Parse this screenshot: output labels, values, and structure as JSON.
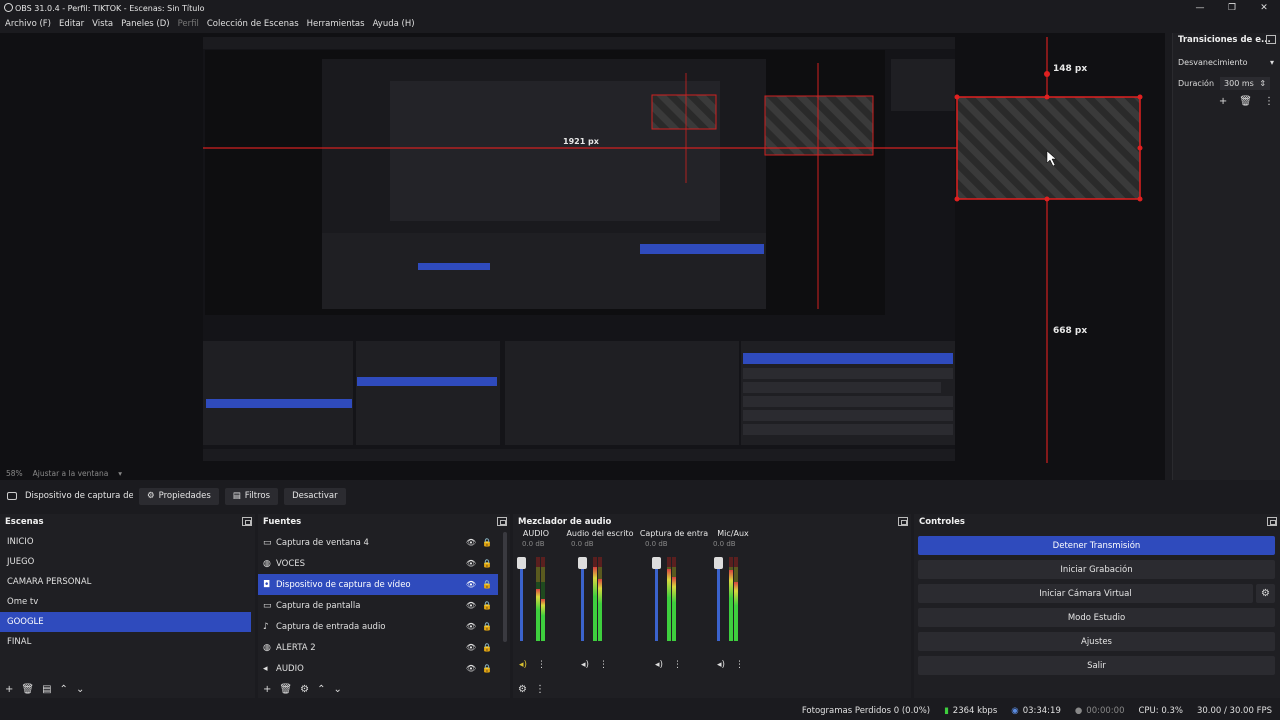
{
  "window": {
    "title": "OBS 31.0.4 - Perfil: TIKTOK - Escenas: Sin Título",
    "minimize": "—",
    "maximize": "❐",
    "close": "✕"
  },
  "menu": [
    "Archivo (F)",
    "Editar",
    "Vista",
    "Paneles (D)",
    "Perfil",
    "Colección de Escenas",
    "Herramientas",
    "Ayuda (H)"
  ],
  "preview": {
    "labels": [
      "148 px",
      "668 px",
      "1921 px"
    ],
    "zoom": "58%",
    "zoom_mode": "Ajustar a la ventana"
  },
  "transitions": {
    "title": "Transiciones de e...",
    "selected": "Desvanecimiento",
    "duration_label": "Duración",
    "duration_value": "300 ms"
  },
  "context": {
    "source_name": "Dispositivo de captura de v",
    "properties": "Propiedades",
    "filters": "Filtros",
    "deactivate": "Desactivar"
  },
  "scenes": {
    "title": "Escenas",
    "items": [
      "INICIO",
      "JUEGO",
      "CAMARA PERSONAL",
      "Ome tv",
      "GOOGLE",
      "FINAL"
    ],
    "selected_index": 4
  },
  "sources": {
    "title": "Fuentes",
    "items": [
      {
        "label": "Captura de ventana 4",
        "icon": "window-icon"
      },
      {
        "label": "VOCES",
        "icon": "globe-icon"
      },
      {
        "label": "Dispositivo de captura de vídeo",
        "icon": "camera-icon"
      },
      {
        "label": "Captura de pantalla",
        "icon": "monitor-icon"
      },
      {
        "label": "Captura de entrada audio",
        "icon": "mic-icon"
      },
      {
        "label": "ALERTA 2",
        "icon": "globe-icon"
      },
      {
        "label": "AUDIO",
        "icon": "speaker-icon"
      }
    ],
    "selected_index": 2
  },
  "mixer": {
    "title": "Mezclador de audio",
    "channels": [
      {
        "name": "AUDIO",
        "db": "0.0 dB",
        "level_l": 0.62,
        "level_r": 0.5
      },
      {
        "name": "Audio del escrito",
        "db": "0.0 dB",
        "level_l": 0.88,
        "level_r": 0.74
      },
      {
        "name": "Captura de entra",
        "db": "0.0 dB",
        "level_l": 0.86,
        "level_r": 0.76
      },
      {
        "name": "Mic/Aux",
        "db": "0.0 dB",
        "level_l": 0.84,
        "level_r": 0.7
      }
    ],
    "scale": [
      "0",
      "-5",
      "-10",
      "-15",
      "-20",
      "-25",
      "-30",
      "-35",
      "-40",
      "-45",
      "-50",
      "-55",
      "-60"
    ]
  },
  "controls": {
    "title": "Controles",
    "buttons": [
      "Detener Transmisión",
      "Iniciar Grabación",
      "Iniciar Cámara Virtual",
      "Modo Estudio",
      "Ajustes",
      "Salir"
    ]
  },
  "status": {
    "dropped": "Fotogramas Perdidos 0 (0.0%)",
    "bitrate": "2364 kbps",
    "stream_time": "03:34:19",
    "rec_time": "00:00:00",
    "cpu": "CPU: 0.3%",
    "fps": "30.00 / 30.00 FPS"
  }
}
